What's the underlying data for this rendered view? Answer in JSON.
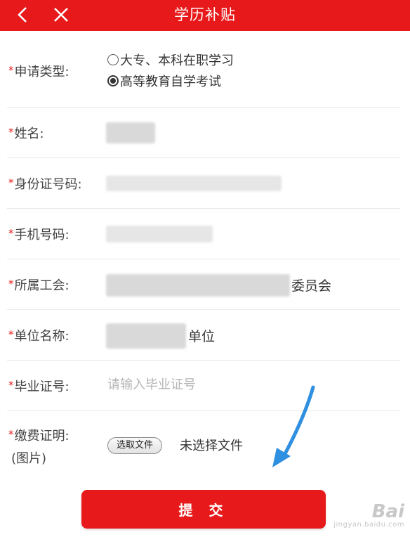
{
  "header": {
    "title": "学历补贴",
    "background": "#e8191a"
  },
  "form": {
    "required_mark": "*",
    "application_type": {
      "label": "申请类型:",
      "options": [
        {
          "text": "大专、本科在职学习",
          "checked": false
        },
        {
          "text": "高等教育自学考试",
          "checked": true
        }
      ]
    },
    "name": {
      "label": "姓名:"
    },
    "id_number": {
      "label": "身份证号码:"
    },
    "phone": {
      "label": "手机号码:"
    },
    "union": {
      "label": "所属工会:",
      "visible_suffix": "委员会"
    },
    "employer": {
      "label": "单位名称:",
      "visible_suffix": "单位"
    },
    "graduation_cert": {
      "label": "毕业证号:",
      "placeholder": "请输入毕业证号"
    },
    "payment_proof": {
      "label": "缴费证明:",
      "label_sub": "(图片)",
      "file_button": "选取文件",
      "file_status": "未选择文件"
    }
  },
  "submit_label": "提 交",
  "watermark": {
    "logo": "Bai",
    "url": "jingyan.baidu.com"
  },
  "annotation": {
    "arrow_color": "#2f8fe0"
  }
}
